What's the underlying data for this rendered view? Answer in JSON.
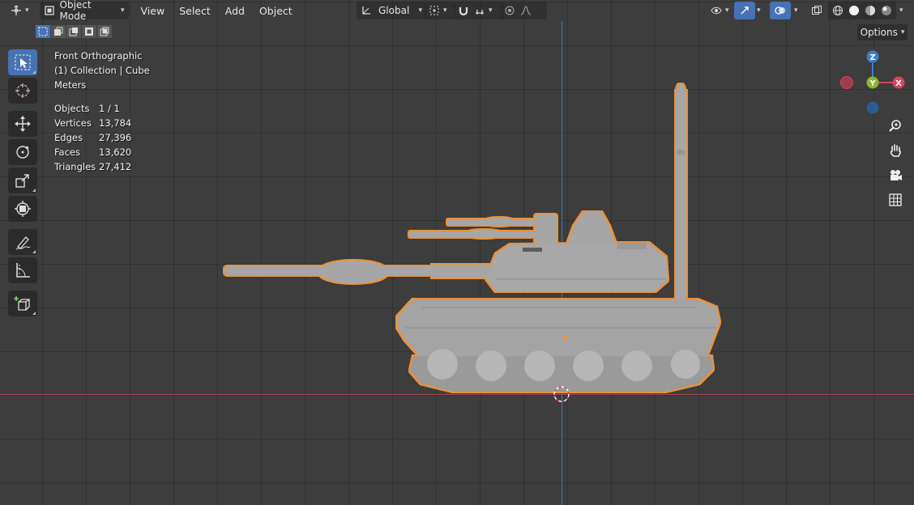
{
  "header": {
    "editor_type_icon": "editor-type-icon",
    "mode": "Object Mode",
    "menus": [
      "View",
      "Select",
      "Add",
      "Object"
    ],
    "transform_orientation": "Global"
  },
  "options_label": "Options",
  "overlay": {
    "view_name": "Front Orthographic",
    "collection": "(1) Collection | Cube",
    "units": "Meters",
    "stats": [
      {
        "label": "Objects",
        "value": "1 / 1"
      },
      {
        "label": "Vertices",
        "value": "13,784"
      },
      {
        "label": "Edges",
        "value": "27,396"
      },
      {
        "label": "Faces",
        "value": "13,620"
      },
      {
        "label": "Triangles",
        "value": "27,412"
      }
    ]
  },
  "gizmo": {
    "x_label": "X",
    "y_label": "Y",
    "z_label": "Z"
  },
  "colors": {
    "accent": "#4772b3",
    "selection_outline": "#e8923a",
    "x_axis": "#d5455a",
    "y_axis": "#8bb62f",
    "z_axis": "#3a7fd0",
    "model": "#a8a8a8"
  },
  "icons": {
    "tools": [
      "select-box-icon",
      "cursor-icon",
      "move-icon",
      "rotate-icon",
      "scale-icon",
      "transform-icon",
      "annotate-icon",
      "measure-icon",
      "add-cube-icon"
    ],
    "nav": [
      "zoom-icon",
      "pan-hand-icon",
      "camera-icon",
      "grid-ortho-icon"
    ]
  }
}
